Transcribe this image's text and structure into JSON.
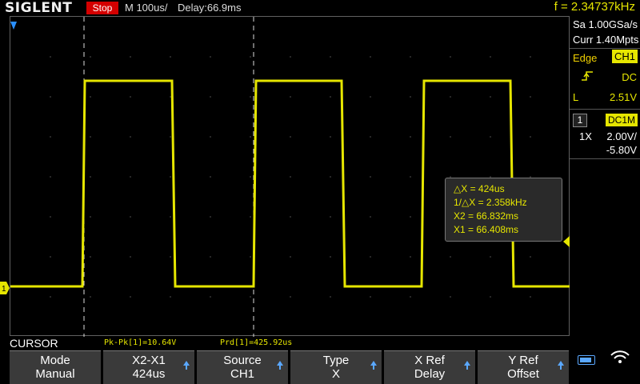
{
  "header": {
    "brand": "SIGLENT",
    "run_state": "Stop",
    "timebase": "M 100us/",
    "delay": "Delay:66.9ms",
    "frequency": "f = 2.34737kHz"
  },
  "panel": {
    "sample_rate": "Sa 1.00GSa/s",
    "memory": "Curr 1.40Mpts",
    "trigger_type": "Edge",
    "trigger_source": "CH1",
    "trigger_coupling": "DC",
    "trigger_slope_icon": "rising-edge-icon",
    "trigger_level_label": "L",
    "trigger_level": "2.51V",
    "channel_number": "1",
    "channel_coupling": "DC1M",
    "probe": "1X",
    "volts_div": "2.00V/",
    "offset": "-5.80V"
  },
  "cursor_readout": {
    "delta_x": "△X = 424us",
    "inv_delta_x": "1/△X = 2.358kHz",
    "x2": "X2 = 66.832ms",
    "x1": "X1 = 66.408ms"
  },
  "measurements": {
    "title": "CURSOR",
    "pk_pk": "Pk-Pk[1]=10.64V",
    "period": "Prd[1]=425.92us"
  },
  "softkeys": [
    {
      "line1": "Mode",
      "line2": "Manual",
      "arrow": false
    },
    {
      "line1": "X2-X1",
      "line2": "424us",
      "arrow": true
    },
    {
      "line1": "Source",
      "line2": "CH1",
      "arrow": true
    },
    {
      "line1": "Type",
      "line2": "X",
      "arrow": true
    },
    {
      "line1": "X Ref",
      "line2": "Delay",
      "arrow": true
    },
    {
      "line1": "Y Ref",
      "line2": "Offset",
      "arrow": true
    }
  ],
  "waveform": {
    "channel_marker": "1",
    "color": "#e6e600",
    "duty_cycle": 0.5
  },
  "colors": {
    "accent": "#e6e600",
    "stop": "#d40000",
    "softkey_arrow": "#5aa8ff"
  },
  "status_icons": [
    "battery-icon",
    "wifi-icon"
  ]
}
